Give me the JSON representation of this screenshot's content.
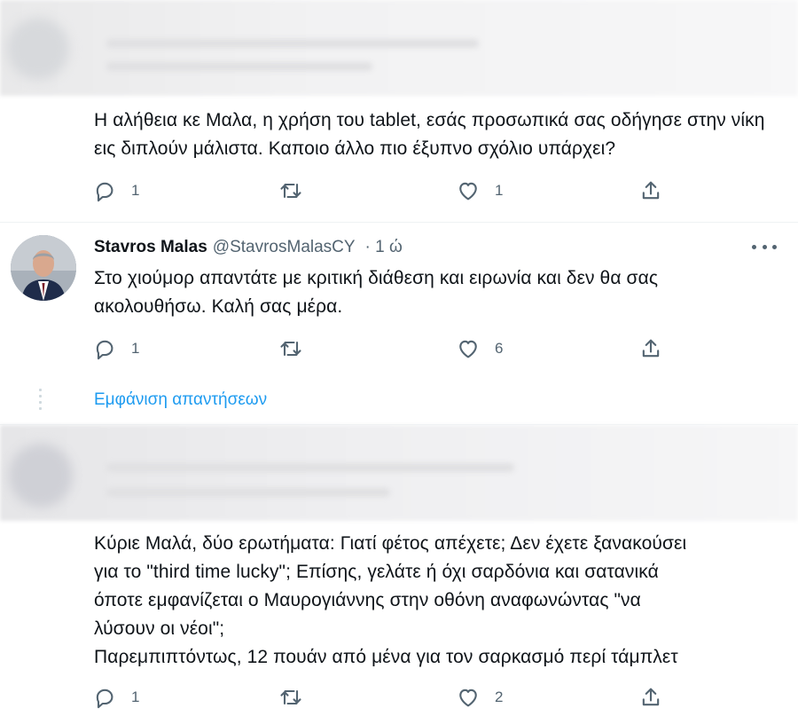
{
  "tweets": [
    {
      "text": "Η αλήθεια κε Μαλα, η χρήση του tablet, εσάς προσωπικά σας οδήγησε στην νίκη εις διπλούν μάλιστα. Καποιο άλλο πιο έξυπνο σχόλιο υπάρχει?",
      "reply_count": "1",
      "retweet_count": "",
      "like_count": "1"
    },
    {
      "author_name": "Stavros Malas",
      "author_handle": "@StavrosMalasCY",
      "time": "· 1 ώ",
      "text": "Στο χιούμορ απαντάτε με κριτική διάθεση και ειρωνία και δεν θα σας ακολουθήσω. Καλή σας μέρα.",
      "reply_count": "1",
      "retweet_count": "",
      "like_count": "6"
    },
    {
      "text_lines": [
        "Κύριε Μαλά, δύο ερωτήματα: Γιατί φέτος απέχετε; Δεν έχετε ξανακούσει",
        "για το \"third time lucky\"; Επίσης, γελάτε ή όχι σαρδόνια και σατανικά",
        "όποτε εμφανίζεται ο Μαυρογιάννης στην οθόνη αναφωνώντας \"να",
        "λύσουν οι νέοι\";",
        "Παρεμπιπτόντως, 12 πουάν από μένα για τον σαρκασμό περί τάμπλετ"
      ],
      "reply_count": "1",
      "retweet_count": "",
      "like_count": "2"
    }
  ],
  "show_replies_label": "Εμφάνιση απαντήσεων",
  "icons": {
    "reply": "reply-icon",
    "retweet": "retweet-icon",
    "like": "heart-icon",
    "share": "share-icon",
    "more": "more-icon"
  },
  "colors": {
    "text": "#0f1419",
    "secondary": "#536471",
    "link": "#1d9bf0"
  }
}
